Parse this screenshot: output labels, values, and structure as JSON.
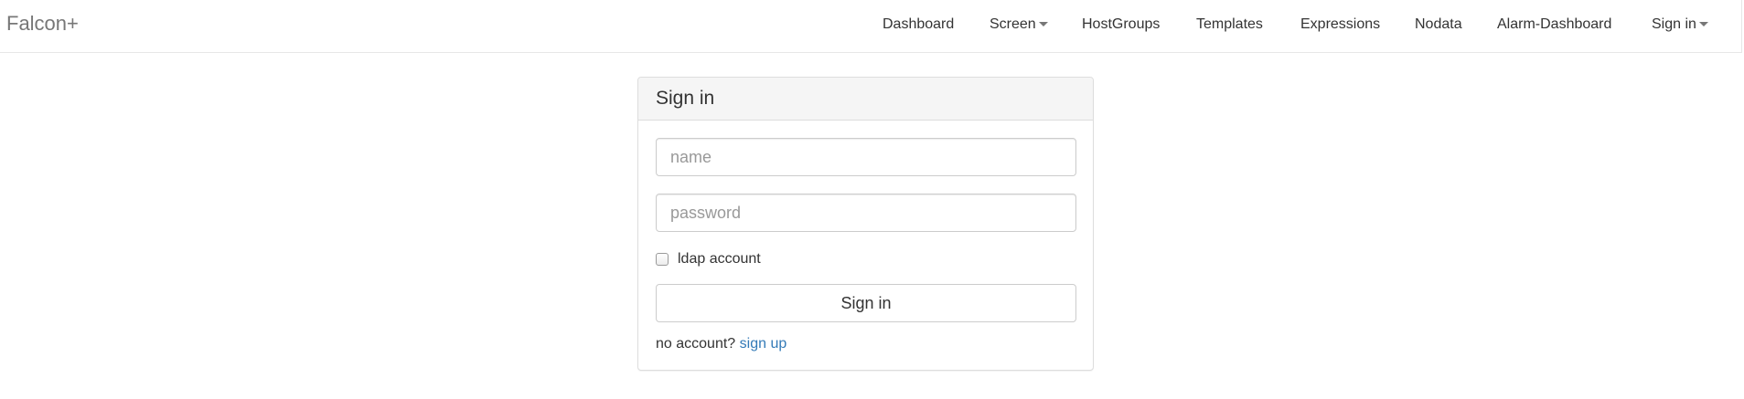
{
  "navbar": {
    "brand": "Falcon+",
    "items": [
      {
        "label": "Dashboard"
      },
      {
        "label": "Screen",
        "dropdown": true
      },
      {
        "label": "HostGroups"
      },
      {
        "label": "Templates"
      },
      {
        "label": "Expressions"
      },
      {
        "label": "Nodata"
      },
      {
        "label": "Alarm-Dashboard"
      },
      {
        "label": "Sign in",
        "dropdown": true
      }
    ]
  },
  "signin": {
    "title": "Sign in",
    "name_placeholder": "name",
    "password_placeholder": "password",
    "ldap_label": "ldap account",
    "ldap_checked": false,
    "submit_label": "Sign in",
    "no_account_text": "no account?",
    "signup_link": "sign up"
  },
  "colors": {
    "link": "#337ab7",
    "nav_text": "#777777",
    "panel_heading_bg": "#f5f5f5"
  }
}
